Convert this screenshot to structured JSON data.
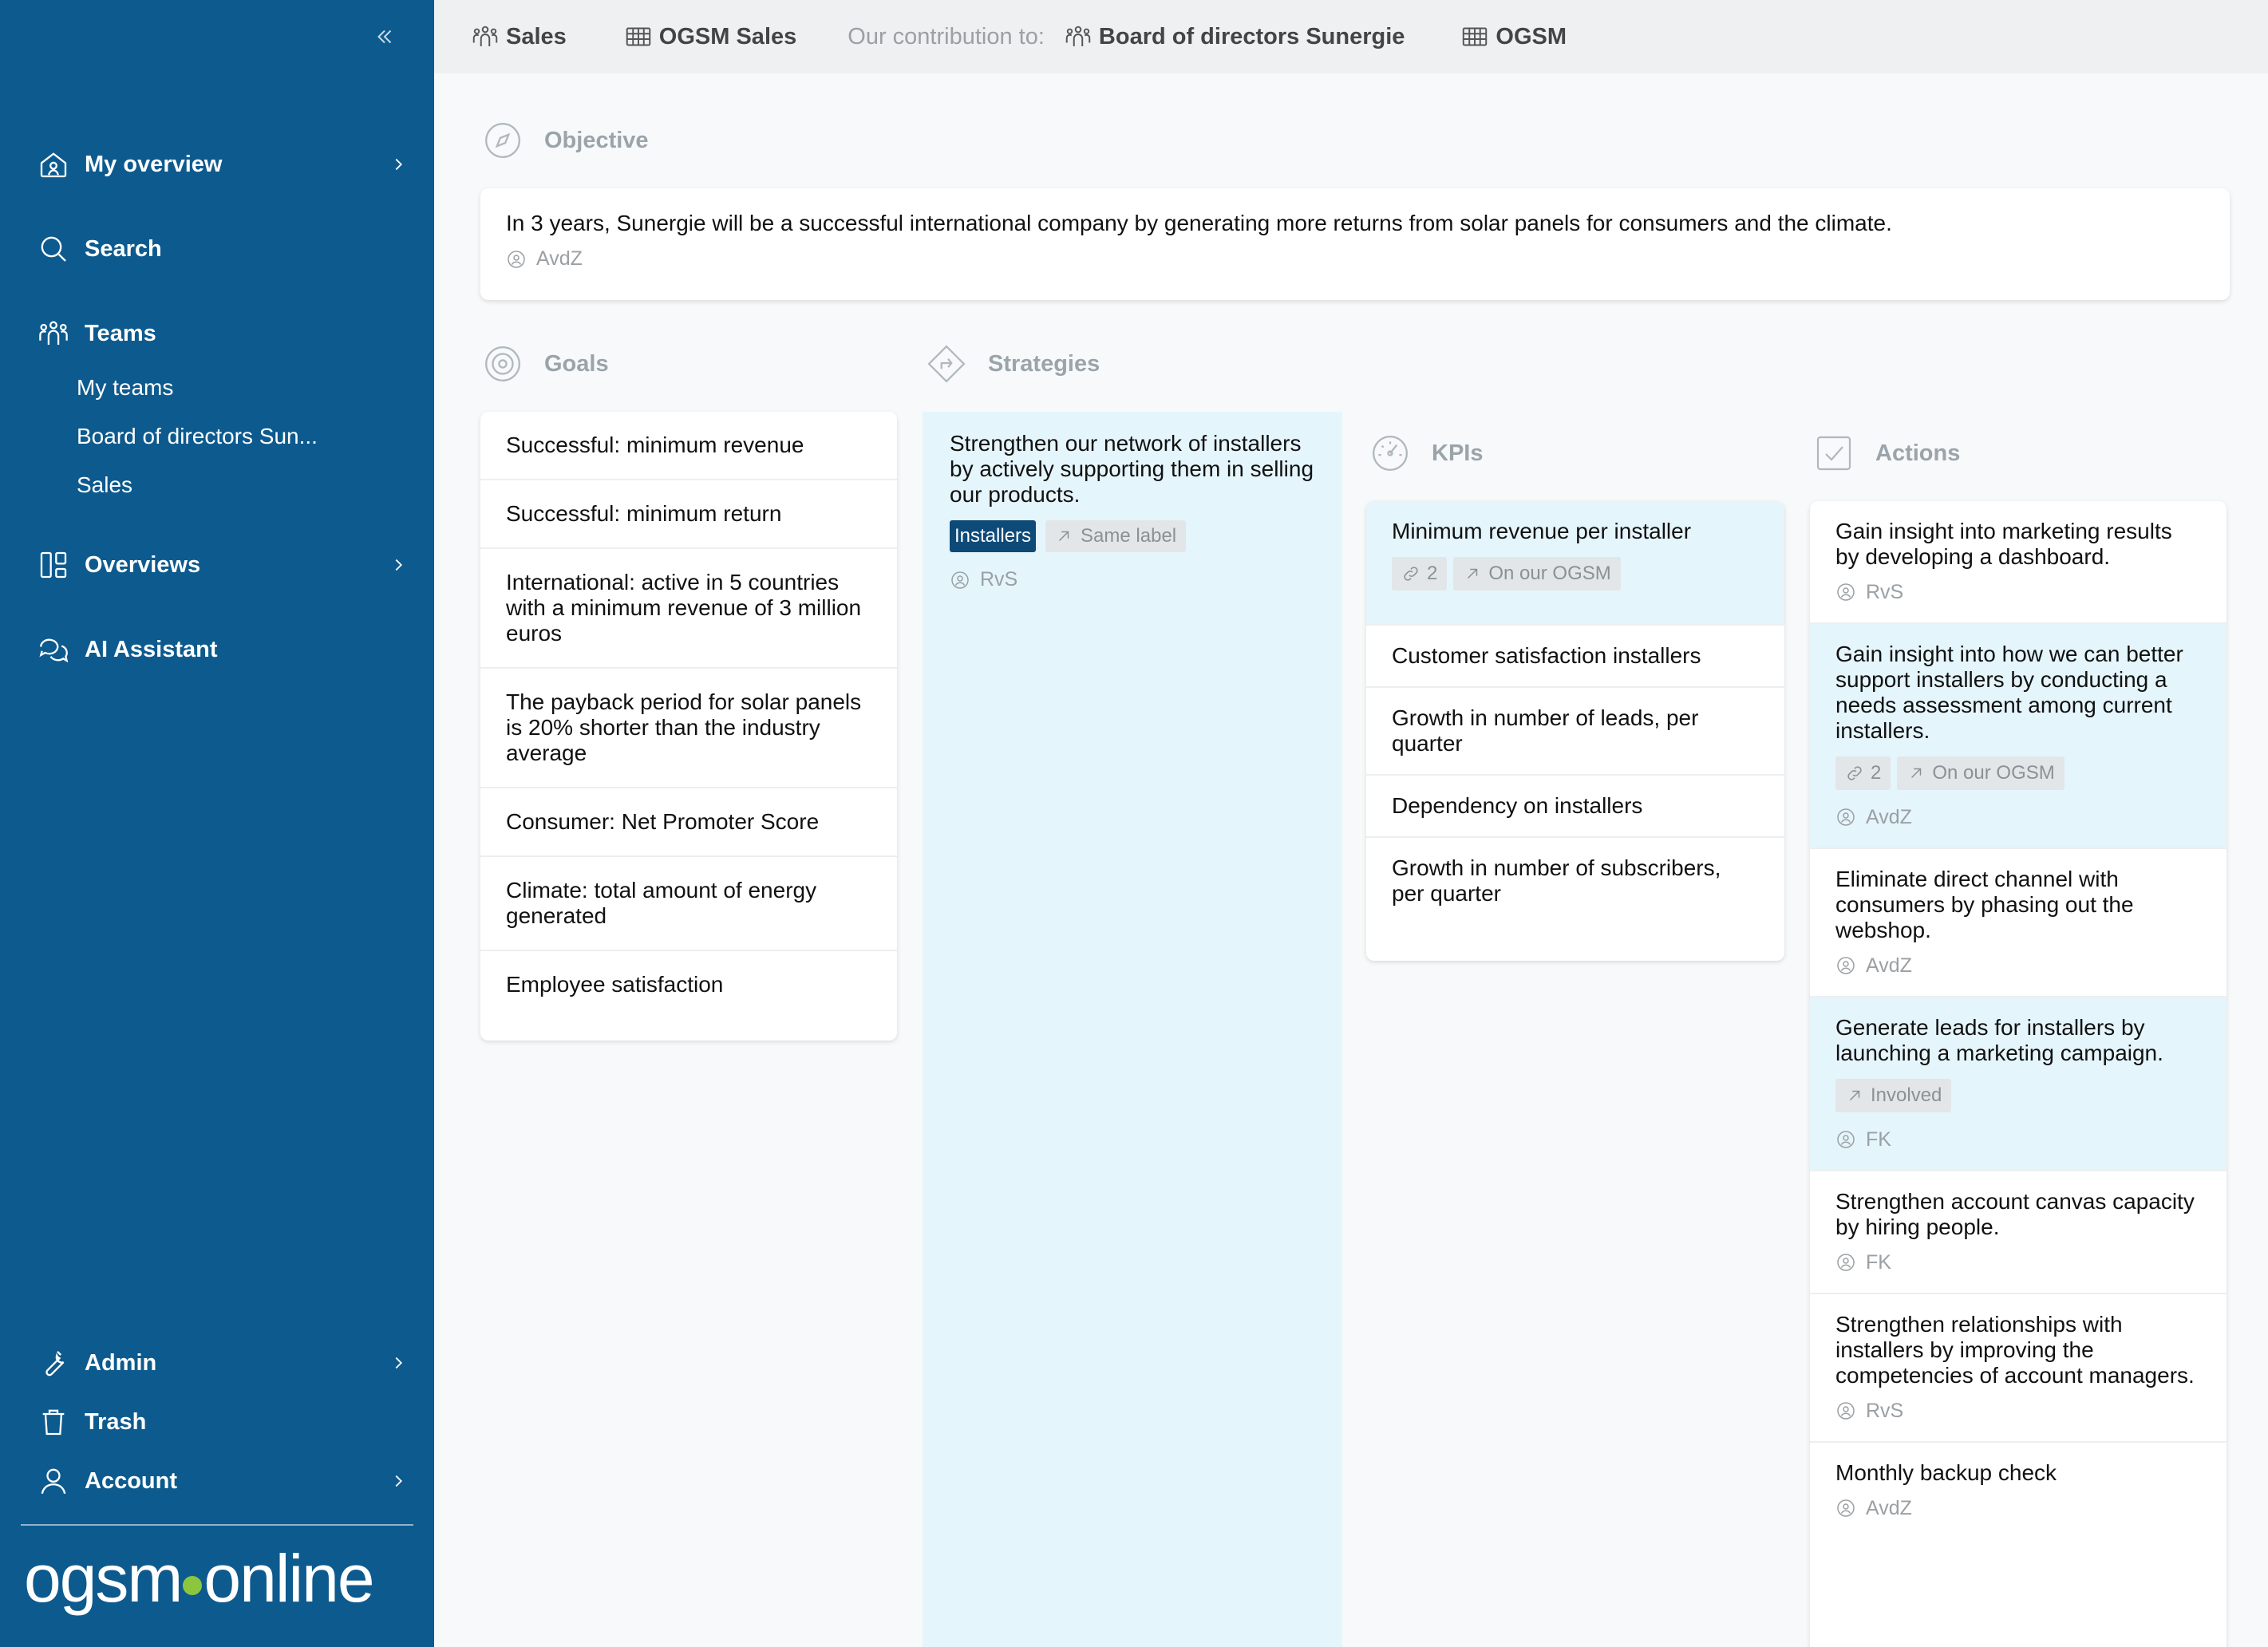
{
  "sidebar": {
    "nav": {
      "my_overview": "My overview",
      "search": "Search",
      "teams": "Teams",
      "overviews": "Overviews",
      "ai_assistant": "AI Assistant",
      "admin": "Admin",
      "trash": "Trash",
      "account": "Account"
    },
    "teams_sub": [
      "My teams",
      "Board of directors Sun...",
      "Sales"
    ],
    "logo_left": "ogsm",
    "logo_right": "online"
  },
  "topbar": {
    "crumb_team": "Sales",
    "crumb_ogsm": "OGSM Sales",
    "contribution_label": "Our contribution to:",
    "crumb_parent_team": "Board of directors Sunergie",
    "crumb_parent_ogsm": "OGSM"
  },
  "objective": {
    "header": "Objective",
    "text": "In 3 years, Sunergie will be a successful international company by generating more returns from solar panels for consumers and the climate.",
    "owner": "AvdZ"
  },
  "goals": {
    "header": "Goals",
    "items": [
      "Successful: minimum revenue",
      "Successful: minimum return",
      "International: active in 5 countries with a minimum revenue of 3 million euros",
      "The payback period for solar panels is 20% shorter than the industry average",
      "Consumer: Net Promoter Score",
      "Climate: total amount of energy generated",
      "Employee satisfaction"
    ]
  },
  "strategies": {
    "header": "Strategies",
    "item": {
      "text": "Strengthen our network of installers by actively supporting them in selling our products.",
      "tag": "Installers",
      "tag_link": "Same label",
      "owner": "RvS"
    }
  },
  "kpis": {
    "header": "KPIs",
    "items": [
      {
        "text": "Minimum revenue per installer",
        "links": "2",
        "badge": "On our OGSM"
      },
      {
        "text": "Customer satisfaction installers"
      },
      {
        "text": "Growth in number of leads, per quarter"
      },
      {
        "text": "Dependency on installers"
      },
      {
        "text": "Growth in number of subscribers, per quarter"
      }
    ]
  },
  "actions": {
    "header": "Actions",
    "items": [
      {
        "text": "Gain insight into marketing results by developing a dashboard.",
        "owner": "RvS"
      },
      {
        "text": "Gain insight into how we can better support installers by conducting a needs assessment among current installers.",
        "links": "2",
        "badge": "On our OGSM",
        "owner": "AvdZ"
      },
      {
        "text": "Eliminate direct channel with consumers by phasing out the webshop.",
        "owner": "AvdZ"
      },
      {
        "text": "Generate leads for installers by launching a marketing campaign.",
        "badge": "Involved",
        "owner": "FK"
      },
      {
        "text": "Strengthen account canvas capacity by hiring people.",
        "owner": "FK"
      },
      {
        "text": "Strengthen relationships with installers by improving the competencies of account managers.",
        "owner": "RvS"
      },
      {
        "text": "Monthly backup check",
        "owner": "AvdZ"
      }
    ]
  }
}
